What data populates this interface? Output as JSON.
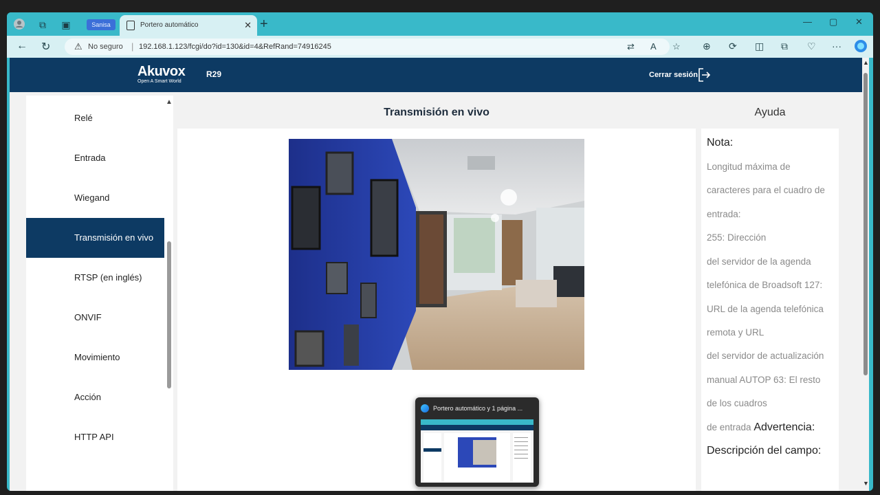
{
  "browser": {
    "workspace_label": "Sanisa",
    "tab_title": "Portero automático",
    "new_tab_glyph": "+",
    "security_label": "No seguro",
    "url": "192.168.1.123/fcgi/do?id=130&id=4&RefRand=74916245"
  },
  "header": {
    "brand": "Akuvox",
    "tagline": "Open A Smart World",
    "model": "R29",
    "logout_label": "Cerrar sesión"
  },
  "sidebar": {
    "items": [
      {
        "label": "Relé"
      },
      {
        "label": "Entrada"
      },
      {
        "label": "Wiegand"
      },
      {
        "label": "Transmisión en vivo"
      },
      {
        "label": "RTSP (en inglés)"
      },
      {
        "label": "ONVIF"
      },
      {
        "label": "Movimiento"
      },
      {
        "label": "Acción"
      },
      {
        "label": "HTTP API"
      }
    ],
    "active_index": 3
  },
  "main": {
    "title": "Transmisión en vivo"
  },
  "help": {
    "title": "Ayuda",
    "note_label": "Nota:",
    "lines": [
      "Longitud máxima de",
      "caracteres para el cuadro de",
      "entrada:",
      "255: Dirección",
      "del servidor de la agenda",
      "telefónica de Broadsoft 127:",
      "URL de la agenda telefónica",
      "remota y URL",
      "del servidor de actualización",
      "manual AUTOP 63: El resto",
      "de los cuadros"
    ],
    "last_line_prefix": "de entrada",
    "warning_label": "Advertencia:",
    "field_description_label": "Descripción del campo:"
  },
  "taskbar_preview": {
    "title": "Portero automático y 1 página ..."
  },
  "colors": {
    "browser_chrome": "#39b9c9",
    "header_bg": "#0d3a63",
    "active_menu_bg": "#0d3a63"
  }
}
